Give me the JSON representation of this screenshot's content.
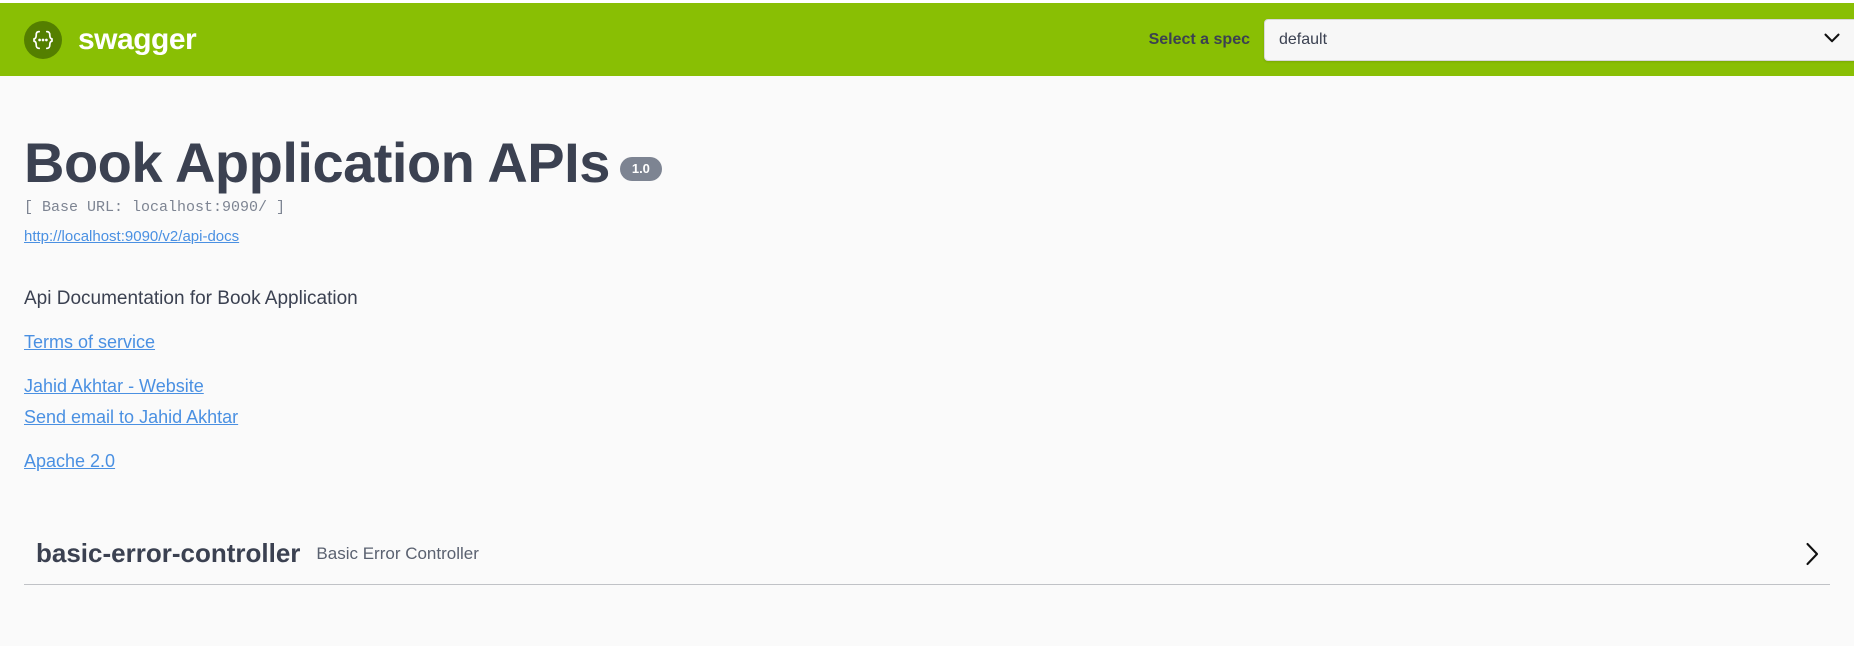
{
  "header": {
    "logo_text": "swagger",
    "logo_icon": "swagger-braces-icon",
    "spec_label": "Select a spec",
    "spec_selected": "default",
    "spec_options": [
      "default"
    ],
    "dropdown_icon": "chevron-down-icon",
    "bar_color": "#89bf04",
    "logo_circle_color": "#547f00"
  },
  "info": {
    "title": "Book Application APIs",
    "version": "1.0",
    "base_url": "[ Base URL: localhost:9090/ ]",
    "api_docs_url_text": "http://localhost:9090/v2/api-docs",
    "description": "Api Documentation for Book Application",
    "links": [
      {
        "label": "Terms of service",
        "spacing": "loose"
      },
      {
        "label": "Jahid Akhtar - Website",
        "spacing": "tight"
      },
      {
        "label": "Send email to Jahid Akhtar",
        "spacing": "loose"
      },
      {
        "label": "Apache 2.0",
        "spacing": "loose"
      }
    ],
    "link_color": "#4a90e2",
    "title_color": "#3b4151",
    "version_badge_color": "#7d8492"
  },
  "tags": [
    {
      "name": "basic-error-controller",
      "description": "Basic Error Controller",
      "expand_icon": "chevron-right-icon",
      "expanded": false
    }
  ]
}
